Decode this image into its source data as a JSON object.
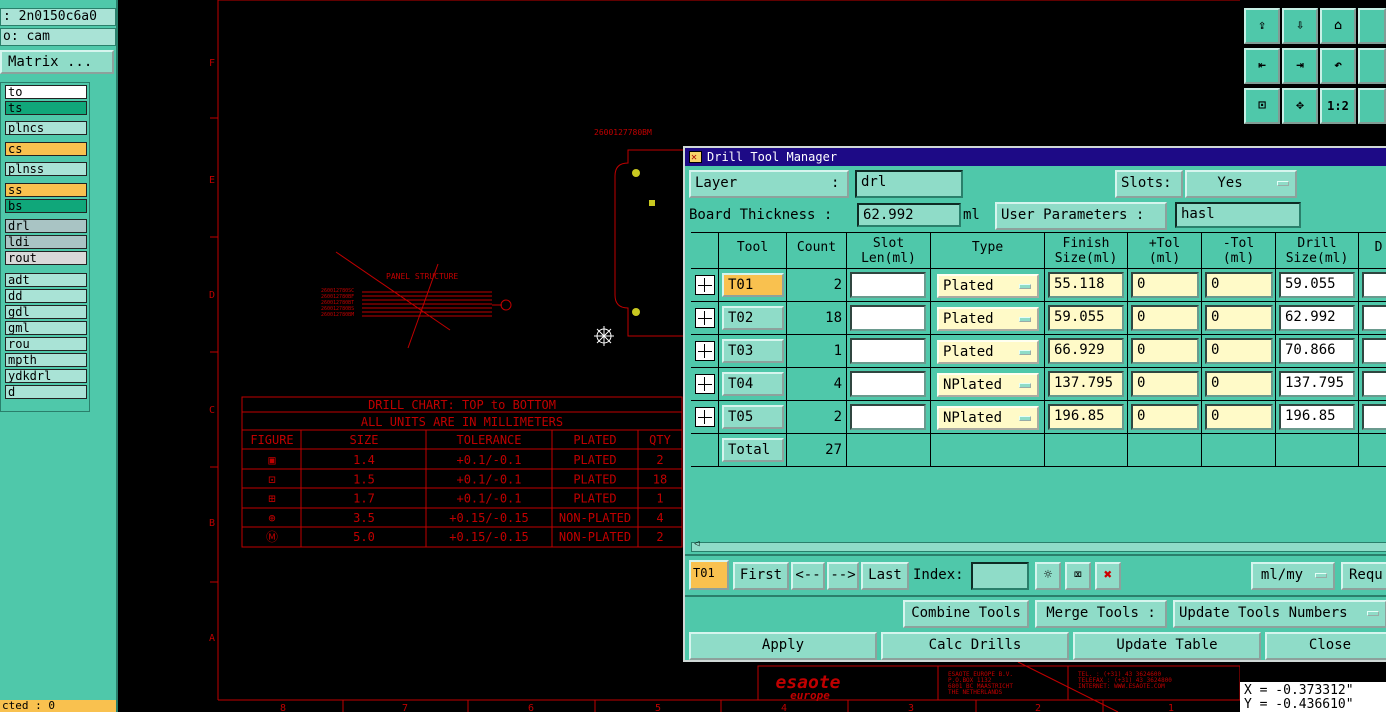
{
  "left_panel": {
    "job_line": ": 2n0150c6a0",
    "user_line": "o: cam",
    "matrix_button": "Matrix ...",
    "layers": [
      {
        "name": "to",
        "color": "#ffffff"
      },
      {
        "name": "ts",
        "color": "#10a77a"
      },
      {
        "name": "plncs",
        "color": "#a9e3d6"
      },
      {
        "name": "cs",
        "color": "#f9c14f"
      },
      {
        "name": "plnss",
        "color": "#a9e3d6"
      },
      {
        "name": "ss",
        "color": "#f9c14f"
      },
      {
        "name": "bs",
        "color": "#10a77a"
      },
      {
        "name": "drl",
        "color": "#a9c4c4"
      },
      {
        "name": "ldi",
        "color": "#a9c4c4"
      },
      {
        "name": "rout",
        "color": "#d9d9d9"
      },
      {
        "name": "adt",
        "color": "#a9e3d6"
      },
      {
        "name": "dd",
        "color": "#a9e3d6"
      },
      {
        "name": "gdl",
        "color": "#a9e3d6"
      },
      {
        "name": "gml",
        "color": "#a9e3d6"
      },
      {
        "name": "rou",
        "color": "#a9e3d6"
      },
      {
        "name": "mpth",
        "color": "#a9e3d6"
      },
      {
        "name": "ydkdrl",
        "color": "#a9e3d6"
      },
      {
        "name": "d",
        "color": "#a9e3d6"
      }
    ],
    "status": "cted : 0"
  },
  "canvas": {
    "part_number": "2600127780BM",
    "panel_structure_label": "PANEL STRUCTURE",
    "panel_numbers": [
      "260012780SC",
      "260012780BF",
      "260012780BT",
      "260012780BS",
      "260012780BM"
    ],
    "drill_chart": {
      "title": "DRILL CHART: TOP to BOTTOM",
      "subtitle": "ALL UNITS ARE IN MILLIMETERS",
      "headers": [
        "FIGURE",
        "SIZE",
        "TOLERANCE",
        "PLATED",
        "QTY"
      ],
      "rows": [
        {
          "figure": "▣",
          "size": "1.4",
          "tol": "+0.1/-0.1",
          "plated": "PLATED",
          "qty": "2"
        },
        {
          "figure": "⊡",
          "size": "1.5",
          "tol": "+0.1/-0.1",
          "plated": "PLATED",
          "qty": "18"
        },
        {
          "figure": "⊞",
          "size": "1.7",
          "tol": "+0.1/-0.1",
          "plated": "PLATED",
          "qty": "1"
        },
        {
          "figure": "⊕",
          "size": "3.5",
          "tol": "+0.15/-0.15",
          "plated": "NON-PLATED",
          "qty": "4"
        },
        {
          "figure": "Ⓜ",
          "size": "5.0",
          "tol": "+0.15/-0.15",
          "plated": "NON-PLATED",
          "qty": "2"
        }
      ]
    },
    "row_letters": [
      "F",
      "E",
      "D",
      "C",
      "B",
      "A"
    ],
    "col_numbers": [
      "8",
      "7",
      "6",
      "5",
      "4",
      "3",
      "2",
      "1"
    ],
    "logo_text": [
      "esaote",
      "europe"
    ],
    "address_lines": [
      "ESAOTE EUROPE B.V.",
      "P.O.BOX 1132",
      "6801 BC MAASTRICHT",
      "THE NETHERLANDS"
    ],
    "contact_lines": [
      "TEL.    : (+31) 43 3624600",
      "TELEFAX : (+31) 43 3624800",
      "INTERNET: WWW.ESAOTE.COM"
    ]
  },
  "right_panel": {
    "icons": [
      "page-up-icon",
      "page-down-icon",
      "home-icon",
      "",
      "pan-left-icon",
      "pan-right-icon",
      "undo-view-icon",
      "",
      "zoom-fit-icon",
      "zoom-center-icon",
      "scale-1-2-icon"
    ],
    "scale_label": "1:2",
    "coord_x": "X = -0.373312\"",
    "coord_y": "Y = -0.436610\""
  },
  "dialog": {
    "title": "Drill Tool Manager",
    "layer_label": "Layer",
    "layer_sep": ":",
    "layer_value": "drl",
    "slots_label": "Slots:",
    "slots_value": "Yes",
    "board_thickness_label": "Board Thickness :",
    "board_thickness_value": "62.992",
    "board_thickness_unit": "ml",
    "user_params_label": "User Parameters :",
    "user_params_value": "hasl",
    "columns": [
      "Tool",
      "Count",
      "Slot\nLen(ml)",
      "Type",
      "Finish\nSize(ml)",
      "+Tol\n(ml)",
      "-Tol\n(ml)",
      "Drill\nSize(ml)",
      "D"
    ],
    "rows": [
      {
        "tool": "T01",
        "count": "2",
        "slot": "",
        "type": "Plated",
        "finish": "55.118",
        "ptol": "0",
        "mtol": "0",
        "drill": "59.055"
      },
      {
        "tool": "T02",
        "count": "18",
        "slot": "",
        "type": "Plated",
        "finish": "59.055",
        "ptol": "0",
        "mtol": "0",
        "drill": "62.992"
      },
      {
        "tool": "T03",
        "count": "1",
        "slot": "",
        "type": "Plated",
        "finish": "66.929",
        "ptol": "0",
        "mtol": "0",
        "drill": "70.866"
      },
      {
        "tool": "T04",
        "count": "4",
        "slot": "",
        "type": "NPlated",
        "finish": "137.795",
        "ptol": "0",
        "mtol": "0",
        "drill": "137.795"
      },
      {
        "tool": "T05",
        "count": "2",
        "slot": "",
        "type": "NPlated",
        "finish": "196.85",
        "ptol": "0",
        "mtol": "0",
        "drill": "196.85"
      }
    ],
    "total_label": "Total",
    "total_count": "27",
    "nav": {
      "current": "T01",
      "first": "First",
      "prev": "<--",
      "next": "-->",
      "last": "Last",
      "index_label": "Index:",
      "index_value": "",
      "units_value": "ml/my",
      "requ": "Requ"
    },
    "buttons": {
      "combine": "Combine Tools",
      "merge": "Merge Tools :",
      "update_numbers": "Update Tools Numbers",
      "apply": "Apply",
      "calc": "Calc Drills",
      "update_table": "Update Table",
      "close": "Close"
    }
  }
}
